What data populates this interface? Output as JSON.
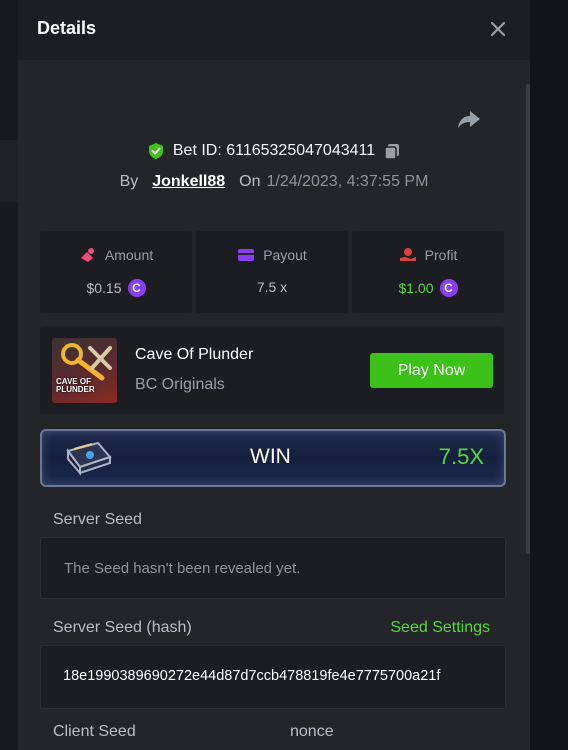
{
  "modal": {
    "title": "Details"
  },
  "bet": {
    "id_text": "Bet ID: 61165325047043411",
    "by_label": "By",
    "username": "Jonkell88",
    "on_label": "On",
    "date": "1/24/2023, 4:37:55 PM"
  },
  "stats": {
    "amount": {
      "label": "Amount",
      "value": "$0.15",
      "coin": "C"
    },
    "payout": {
      "label": "Payout",
      "value": "7.5 x"
    },
    "profit": {
      "label": "Profit",
      "value": "$1.00",
      "coin": "C"
    }
  },
  "game": {
    "thumb_text_1": "CAVE OF",
    "thumb_text_2": "PLUNDER",
    "name": "Cave Of Plunder",
    "provider": "BC Originals",
    "play_label": "Play Now"
  },
  "result": {
    "status": "WIN",
    "multiplier": "7.5X"
  },
  "server_seed": {
    "label": "Server Seed",
    "value": "The Seed hasn't been revealed yet."
  },
  "server_seed_hash": {
    "label": "Server Seed (hash)",
    "settings_link": "Seed Settings",
    "value": "18e1990389690272e44d87d7ccb478819fe4e7775700a21f"
  },
  "client_seed": {
    "label": "Client Seed",
    "nonce_label": "nonce"
  },
  "colors": {
    "accent_green": "#3bc117",
    "win_green": "#55d83b",
    "coin_purple": "#8b3cf5",
    "icon_pink": "#ef4b7b",
    "icon_purple": "#8b3cf5",
    "icon_red": "#e0413c"
  }
}
